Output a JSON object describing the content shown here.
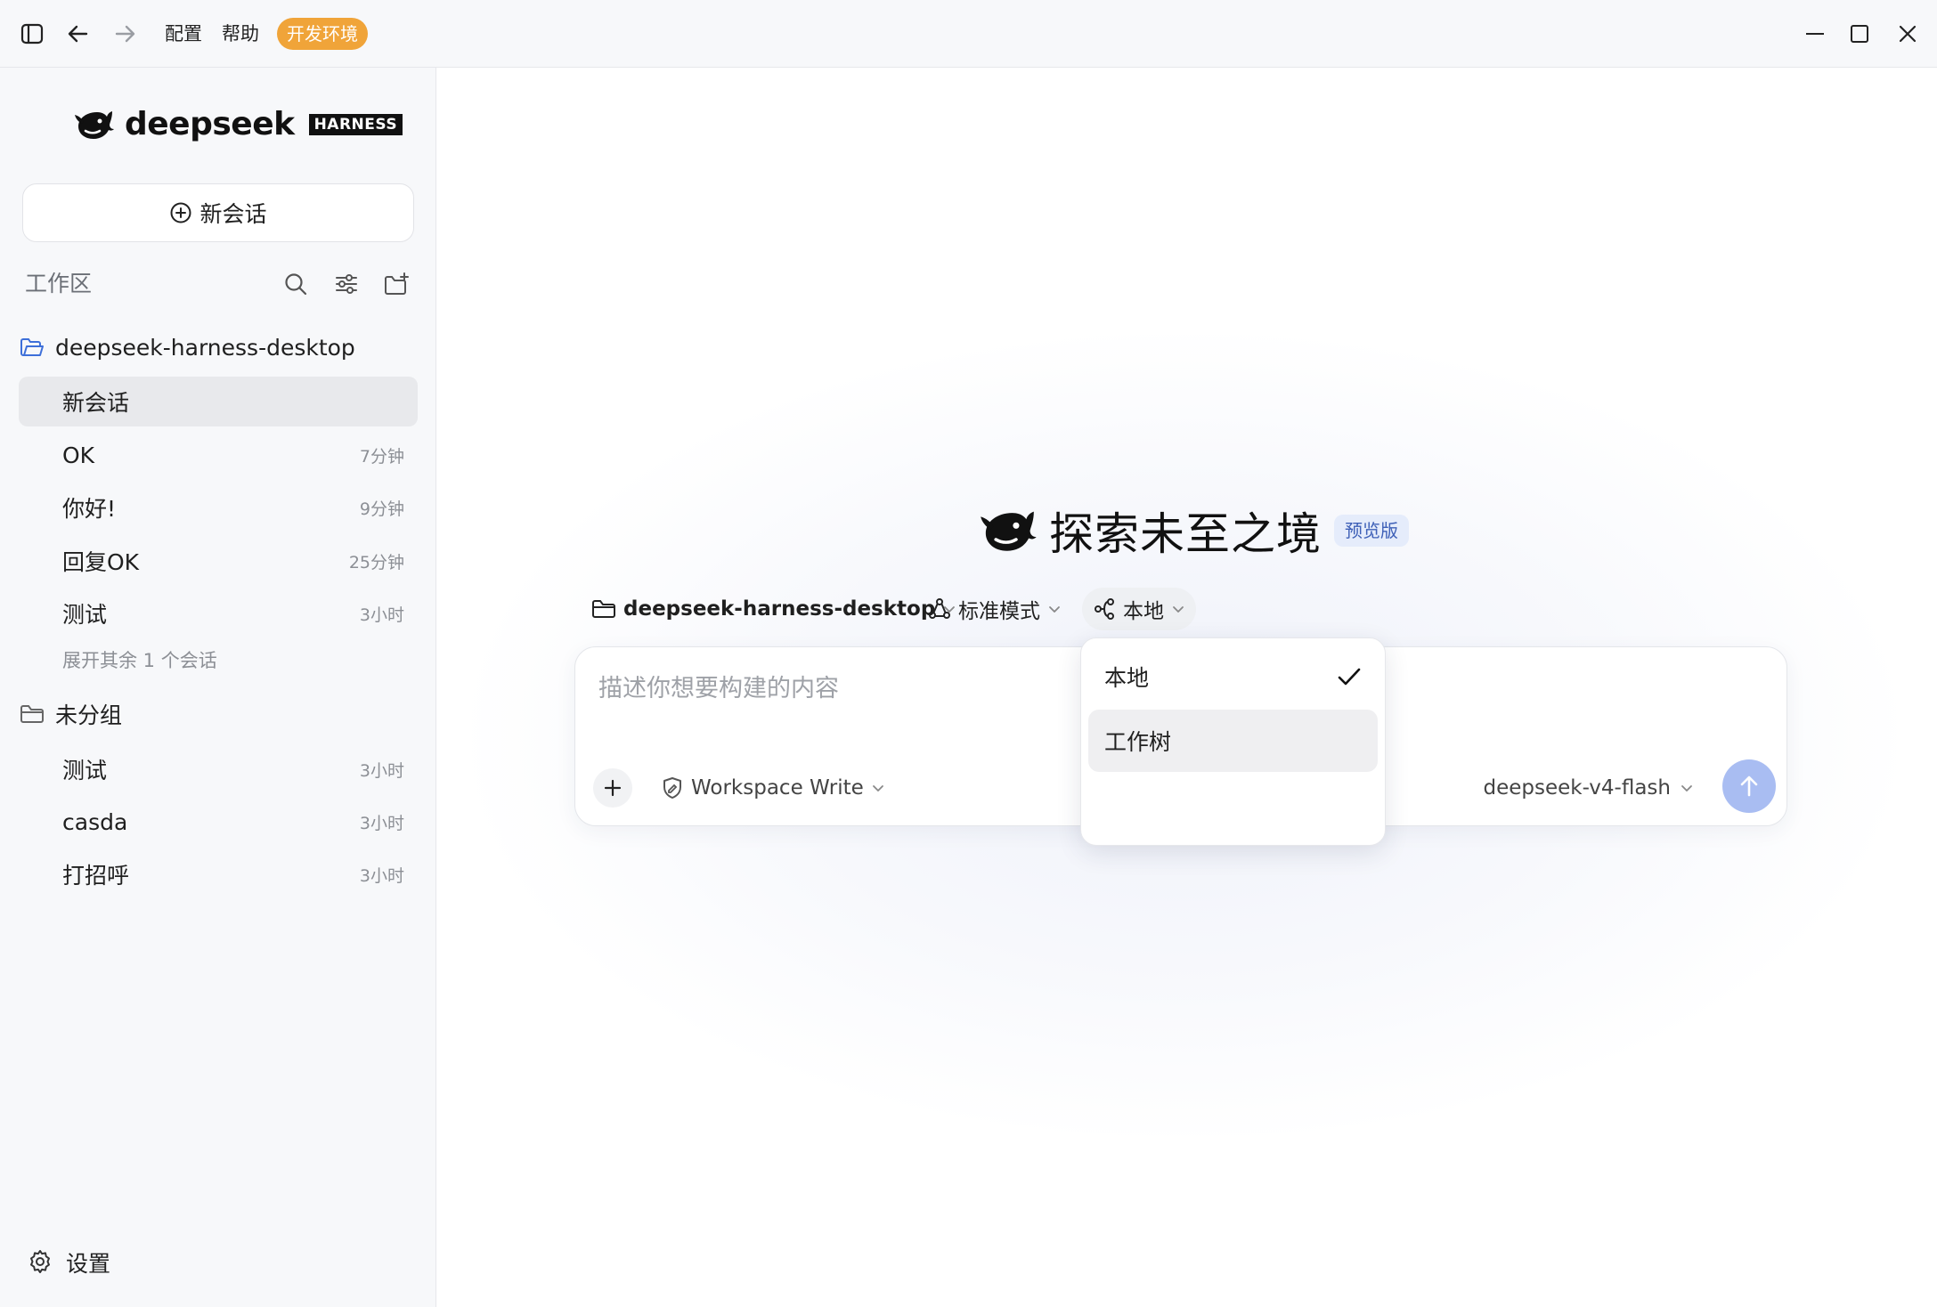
{
  "titlebar": {
    "menu_config": "配置",
    "menu_help": "帮助",
    "env_badge": "开发环境",
    "env_color": "#f0a439"
  },
  "sidebar": {
    "logo_text": "deepseek",
    "logo_badge": "HARNESS",
    "new_chat_label": "新会话",
    "workspace_header": "工作区",
    "groups": [
      {
        "label": "deepseek-harness-desktop",
        "icon": "folder-open-icon",
        "items": [
          {
            "title": "新会话",
            "time": "",
            "active": true
          },
          {
            "title": "OK",
            "time": "7分钟"
          },
          {
            "title": "你好!",
            "time": "9分钟"
          },
          {
            "title": "回复OK",
            "time": "25分钟"
          },
          {
            "title": "测试",
            "time": "3小时"
          }
        ],
        "expand_more": "展开其余 1 个会话"
      },
      {
        "label": "未分组",
        "icon": "folder-icon",
        "items": [
          {
            "title": "测试",
            "time": "3小时"
          },
          {
            "title": "casda",
            "time": "3小时"
          },
          {
            "title": "打招呼",
            "time": "3小时"
          }
        ]
      }
    ],
    "settings_label": "设置"
  },
  "main": {
    "hero_title": "探索未至之境",
    "preview_badge": "预览版",
    "toolbar": {
      "project": "deepseek-harness-desktop",
      "mode": "标准模式",
      "location": "本地"
    },
    "composer": {
      "placeholder": "描述你想要构建的内容",
      "value": "",
      "permission": "Workspace Write",
      "model": "deepseek-v4-flash"
    },
    "location_menu": {
      "options": [
        {
          "label": "本地",
          "selected": true
        },
        {
          "label": "工作树",
          "selected": false
        }
      ]
    }
  },
  "colors": {
    "accent": "#3d5fb7",
    "send_button": "#a9bdf2",
    "active_row": "#e8e9ec"
  }
}
